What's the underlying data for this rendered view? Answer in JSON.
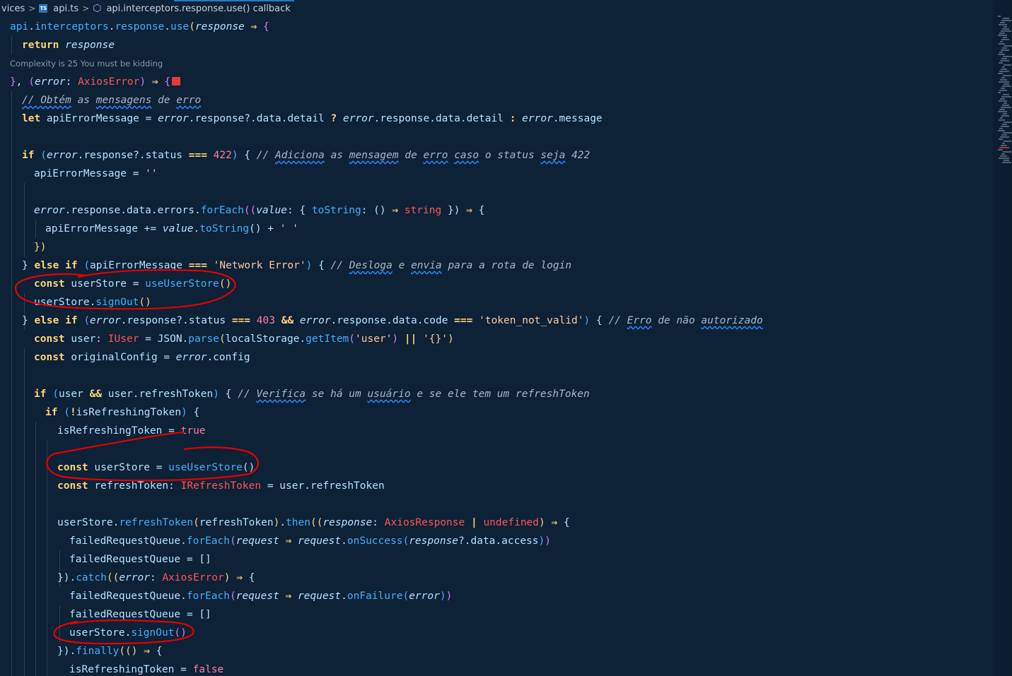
{
  "breadcrumb": {
    "segment_1": "vices",
    "segment_2": "api.ts",
    "segment_3": "api.interceptors.response.use() callback"
  },
  "codelens": "Complexity is 25 You must be kidding",
  "colors": {
    "background": "#0d2137",
    "keyword": "#ffd37a",
    "function": "#40b2ff",
    "string": "#ffc9a0",
    "type": "#ff5555",
    "comment": "#a8b8c8",
    "annotation_circle": "#e60000"
  },
  "icons": {
    "ts_file": "typescript-file-icon",
    "symbol": "method-cube-icon",
    "breakpoint": "red-square-icon"
  },
  "lines": [
    [
      [
        "f",
        "api"
      ],
      [
        "v",
        "."
      ],
      [
        "f",
        "interceptors"
      ],
      [
        "v",
        "."
      ],
      [
        "f",
        "response"
      ],
      [
        "v",
        "."
      ],
      [
        "f",
        "use"
      ],
      [
        "b1",
        "("
      ],
      [
        "p",
        "response"
      ],
      [
        "o",
        " ⇒ "
      ],
      [
        "b2",
        "{"
      ]
    ],
    [
      [
        "k",
        "return "
      ],
      [
        "p",
        "response"
      ]
    ],
    [],
    [
      [
        "b2",
        "}"
      ],
      [
        "v",
        ", "
      ],
      [
        "b2",
        "("
      ],
      [
        "p",
        "error"
      ],
      [
        "v",
        ": "
      ],
      [
        "cl",
        "AxiosError"
      ],
      [
        "b2",
        ")"
      ],
      [
        "o",
        " ⇒ "
      ],
      [
        "b2",
        "{"
      ]
    ],
    [
      [
        "cu",
        "// Obtém"
      ],
      [
        "c",
        " as "
      ],
      [
        "cu",
        "mensagens"
      ],
      [
        "c",
        " de "
      ],
      [
        "cu",
        "erro"
      ]
    ],
    [
      [
        "k",
        "let "
      ],
      [
        "v",
        "apiErrorMessage = "
      ],
      [
        "p",
        "error"
      ],
      [
        "v",
        ".response?.data.detail "
      ],
      [
        "o",
        "?"
      ],
      [
        "v",
        " "
      ],
      [
        "p",
        "error"
      ],
      [
        "v",
        ".response.data.detail "
      ],
      [
        "o",
        ":"
      ],
      [
        "v",
        " "
      ],
      [
        "p",
        "error"
      ],
      [
        "v",
        ".message"
      ]
    ],
    [],
    [
      [
        "k",
        "if "
      ],
      [
        "b3",
        "("
      ],
      [
        "p",
        "error"
      ],
      [
        "v",
        ".response?.status "
      ],
      [
        "o",
        "==="
      ],
      [
        "v",
        " "
      ],
      [
        "n",
        "422"
      ],
      [
        "b3",
        ")"
      ],
      [
        "v",
        " {"
      ],
      [
        "c",
        " // "
      ],
      [
        "cu",
        "Adiciona"
      ],
      [
        "c",
        " as "
      ],
      [
        "cu",
        "mensagem"
      ],
      [
        "c",
        " de "
      ],
      [
        "cu",
        "erro"
      ],
      [
        "c",
        " "
      ],
      [
        "cu",
        "caso"
      ],
      [
        "c",
        " o status "
      ],
      [
        "cu",
        "seja"
      ],
      [
        "c",
        " 422"
      ]
    ],
    [
      [
        "v",
        "apiErrorMessage = "
      ],
      [
        "s",
        "''"
      ]
    ],
    [],
    [
      [
        "p",
        "error"
      ],
      [
        "v",
        ".response.data.errors."
      ],
      [
        "f",
        "forEach"
      ],
      [
        "b2",
        "(("
      ],
      [
        "p",
        "value"
      ],
      [
        "v",
        ": { "
      ],
      [
        "f",
        "toString"
      ],
      [
        "v",
        ": () "
      ],
      [
        "o",
        "⇒"
      ],
      [
        "v",
        " "
      ],
      [
        "cl",
        "string"
      ],
      [
        "v",
        " }) "
      ],
      [
        "o",
        "⇒"
      ],
      [
        "v",
        " {"
      ]
    ],
    [
      [
        "v",
        "apiErrorMessage += "
      ],
      [
        "p",
        "value"
      ],
      [
        "v",
        "."
      ],
      [
        "f",
        "toString"
      ],
      [
        "v",
        "() + "
      ],
      [
        "s",
        "' '"
      ]
    ],
    [
      [
        "b1",
        "})"
      ]
    ],
    [
      [
        "v",
        "} "
      ],
      [
        "k",
        "else if "
      ],
      [
        "b3",
        "("
      ],
      [
        "v",
        "apiErrorMessage "
      ],
      [
        "o",
        "==="
      ],
      [
        "v",
        " "
      ],
      [
        "s",
        "'Network Error'"
      ],
      [
        "b3",
        ")"
      ],
      [
        "v",
        " {"
      ],
      [
        "c",
        " // "
      ],
      [
        "cu",
        "Desloga"
      ],
      [
        "c",
        " e "
      ],
      [
        "cu",
        "envia"
      ],
      [
        "c",
        " para a rota de login"
      ]
    ],
    [
      [
        "k",
        "const "
      ],
      [
        "v",
        "userStore = "
      ],
      [
        "f",
        "useUserStore"
      ],
      [
        "b1",
        "()"
      ]
    ],
    [
      [
        "v",
        "userStore."
      ],
      [
        "f",
        "signOut"
      ],
      [
        "b1",
        "()"
      ]
    ],
    [
      [
        "v",
        "} "
      ],
      [
        "k",
        "else if "
      ],
      [
        "b3",
        "("
      ],
      [
        "p",
        "error"
      ],
      [
        "v",
        ".response?.status "
      ],
      [
        "o",
        "==="
      ],
      [
        "v",
        " "
      ],
      [
        "n",
        "403"
      ],
      [
        "o",
        " && "
      ],
      [
        "p",
        "error"
      ],
      [
        "v",
        ".response.data.code "
      ],
      [
        "o",
        "==="
      ],
      [
        "v",
        " "
      ],
      [
        "s",
        "'token_not_valid'"
      ],
      [
        "b3",
        ")"
      ],
      [
        "v",
        " {"
      ],
      [
        "c",
        " // "
      ],
      [
        "cu",
        "Erro"
      ],
      [
        "c",
        " de não "
      ],
      [
        "cu",
        "autorizado"
      ]
    ],
    [
      [
        "k",
        "const "
      ],
      [
        "v",
        "user: "
      ],
      [
        "cl",
        "IUser"
      ],
      [
        "v",
        " = JSON."
      ],
      [
        "f",
        "parse"
      ],
      [
        "b1",
        "("
      ],
      [
        "v",
        "localStorage."
      ],
      [
        "f",
        "getItem"
      ],
      [
        "b2",
        "("
      ],
      [
        "s",
        "'user'"
      ],
      [
        "b2",
        ")"
      ],
      [
        "o",
        " || "
      ],
      [
        "s",
        "'{}'"
      ],
      [
        "b1",
        ")"
      ]
    ],
    [
      [
        "k",
        "const "
      ],
      [
        "v",
        "originalConfig = "
      ],
      [
        "p",
        "error"
      ],
      [
        "v",
        ".config"
      ]
    ],
    [],
    [
      [
        "k",
        "if "
      ],
      [
        "b3",
        "("
      ],
      [
        "v",
        "user "
      ],
      [
        "o",
        "&&"
      ],
      [
        "v",
        " user.refreshToken"
      ],
      [
        "b3",
        ")"
      ],
      [
        "v",
        " {"
      ],
      [
        "c",
        " // "
      ],
      [
        "cu",
        "Verifica"
      ],
      [
        "c",
        " se há um "
      ],
      [
        "cu",
        "usuário"
      ],
      [
        "c",
        " e se ele tem um refreshToken"
      ]
    ],
    [
      [
        "k",
        "if "
      ],
      [
        "b3",
        "("
      ],
      [
        "o",
        "!"
      ],
      [
        "v",
        "isRefreshingToken"
      ],
      [
        "b3",
        ")"
      ],
      [
        "v",
        " {"
      ]
    ],
    [
      [
        "v",
        "isRefreshingToken = "
      ],
      [
        "n",
        "true"
      ]
    ],
    [],
    [
      [
        "k",
        "const "
      ],
      [
        "v",
        "userStore = "
      ],
      [
        "f",
        "useUserStore"
      ],
      [
        "v",
        "()"
      ]
    ],
    [
      [
        "k",
        "const "
      ],
      [
        "v",
        "refreshToken: "
      ],
      [
        "cl",
        "IRefreshToken"
      ],
      [
        "v",
        " = user.refreshToken"
      ]
    ],
    [],
    [
      [
        "v",
        "userStore."
      ],
      [
        "f",
        "refreshToken"
      ],
      [
        "b1",
        "("
      ],
      [
        "v",
        "refreshToken"
      ],
      [
        "b1",
        ")"
      ],
      [
        "v",
        "."
      ],
      [
        "f",
        "then"
      ],
      [
        "b1",
        "(("
      ],
      [
        "p",
        "response"
      ],
      [
        "v",
        ": "
      ],
      [
        "cl",
        "AxiosResponse"
      ],
      [
        "o",
        " | "
      ],
      [
        "cl",
        "undefined"
      ],
      [
        "b1",
        ")"
      ],
      [
        "o",
        " ⇒ "
      ],
      [
        "v",
        "{"
      ]
    ],
    [
      [
        "v",
        "failedRequestQueue."
      ],
      [
        "f",
        "forEach"
      ],
      [
        "b2",
        "("
      ],
      [
        "p",
        "request"
      ],
      [
        "o",
        " ⇒ "
      ],
      [
        "p",
        "request"
      ],
      [
        "v",
        "."
      ],
      [
        "f",
        "onSuccess"
      ],
      [
        "b3",
        "("
      ],
      [
        "p",
        "response"
      ],
      [
        "v",
        "?.data.access"
      ],
      [
        "b3",
        ")"
      ],
      [
        "b2",
        ")"
      ]
    ],
    [
      [
        "v",
        "failedRequestQueue = []"
      ]
    ],
    [
      [
        "v",
        "})."
      ],
      [
        "f",
        "catch"
      ],
      [
        "b1",
        "(("
      ],
      [
        "p",
        "error"
      ],
      [
        "v",
        ": "
      ],
      [
        "cl",
        "AxiosError"
      ],
      [
        "b1",
        ")"
      ],
      [
        "o",
        " ⇒ "
      ],
      [
        "v",
        "{"
      ]
    ],
    [
      [
        "v",
        "failedRequestQueue."
      ],
      [
        "f",
        "forEach"
      ],
      [
        "b2",
        "("
      ],
      [
        "p",
        "request"
      ],
      [
        "o",
        " ⇒ "
      ],
      [
        "p",
        "request"
      ],
      [
        "v",
        "."
      ],
      [
        "f",
        "onFailure"
      ],
      [
        "b3",
        "("
      ],
      [
        "p",
        "error"
      ],
      [
        "b3",
        ")"
      ],
      [
        "b2",
        ")"
      ]
    ],
    [
      [
        "v",
        "failedRequestQueue = []"
      ]
    ],
    [
      [
        "v",
        "userStore."
      ],
      [
        "f",
        "signOut"
      ],
      [
        "b2",
        "()"
      ]
    ],
    [
      [
        "v",
        "})."
      ],
      [
        "f",
        "finally"
      ],
      [
        "b1",
        "(()"
      ],
      [
        "o",
        " ⇒ "
      ],
      [
        "v",
        "{"
      ]
    ],
    [
      [
        "v",
        "isRefreshingToken = "
      ],
      [
        "n",
        "false"
      ]
    ]
  ]
}
